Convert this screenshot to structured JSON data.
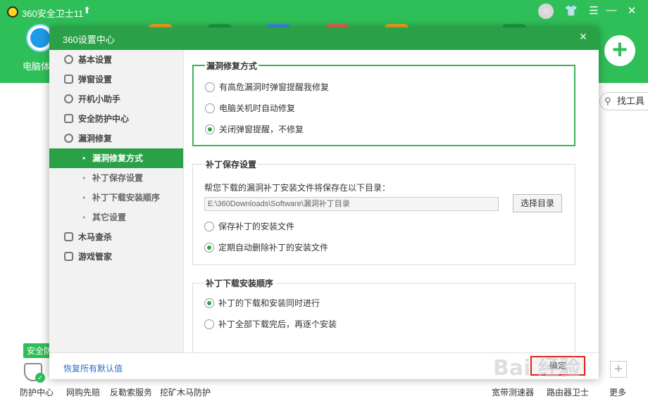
{
  "app": {
    "title": "360安全卫士11",
    "up_icon": "arrow-up",
    "home_label": "电脑体",
    "right_tools": "找工具",
    "plus_icon": "plus"
  },
  "window_controls": {
    "medal": "☆",
    "shirt": "👕",
    "menu": "☰",
    "minimize": "—",
    "close": "✕"
  },
  "bottom": {
    "badge": "安全防",
    "items": [
      "防护中心",
      "网购先赔",
      "反勒索服务",
      "挖矿木马防护"
    ],
    "right_items": [
      "宽带测速器",
      "路由器卫士",
      "更多"
    ]
  },
  "dialog": {
    "title": "360设置中心",
    "close": "×",
    "sidebar": [
      {
        "label": "基本设置",
        "icon": "gear-icon"
      },
      {
        "label": "弹窗设置",
        "icon": "window-icon"
      },
      {
        "label": "开机小助手",
        "icon": "clock-icon"
      },
      {
        "label": "安全防护中心",
        "icon": "list-icon"
      },
      {
        "label": "漏洞修复",
        "icon": "refresh-icon"
      },
      {
        "label": "漏洞修复方式",
        "sub": true,
        "active": true
      },
      {
        "label": "补丁保存设置",
        "sub": true
      },
      {
        "label": "补丁下载安装顺序",
        "sub": true
      },
      {
        "label": "其它设置",
        "sub": true
      },
      {
        "label": "木马查杀",
        "icon": "horse-icon"
      },
      {
        "label": "游戏管家",
        "icon": "gamepad-icon"
      }
    ],
    "groups": {
      "repair_mode": {
        "title": "漏洞修复方式",
        "options": [
          {
            "label": "有高危漏洞时弹窗提醒我修复",
            "checked": false
          },
          {
            "label": "电脑关机时自动修复",
            "checked": false
          },
          {
            "label": "关闭弹窗提醒，不修复",
            "checked": true
          }
        ]
      },
      "patch_save": {
        "title": "补丁保存设置",
        "description": "帮您下载的漏洞补丁安装文件将保存在以下目录：",
        "path": "E:\\360Downloads\\Software\\漏洞补丁目录",
        "browse_button": "选择目录",
        "options": [
          {
            "label": "保存补丁的安装文件",
            "checked": false
          },
          {
            "label": "定期自动删除补丁的安装文件",
            "checked": true
          }
        ]
      },
      "install_order": {
        "title": "补丁下载安装顺序",
        "options": [
          {
            "label": "补丁的下载和安装同时进行",
            "checked": true
          },
          {
            "label": "补丁全部下载完后，再逐个安装",
            "checked": false
          }
        ]
      }
    },
    "footer": {
      "restore_link": "恢复所有默认值",
      "confirm_button": "确定"
    }
  },
  "watermark": "Bai 经验"
}
